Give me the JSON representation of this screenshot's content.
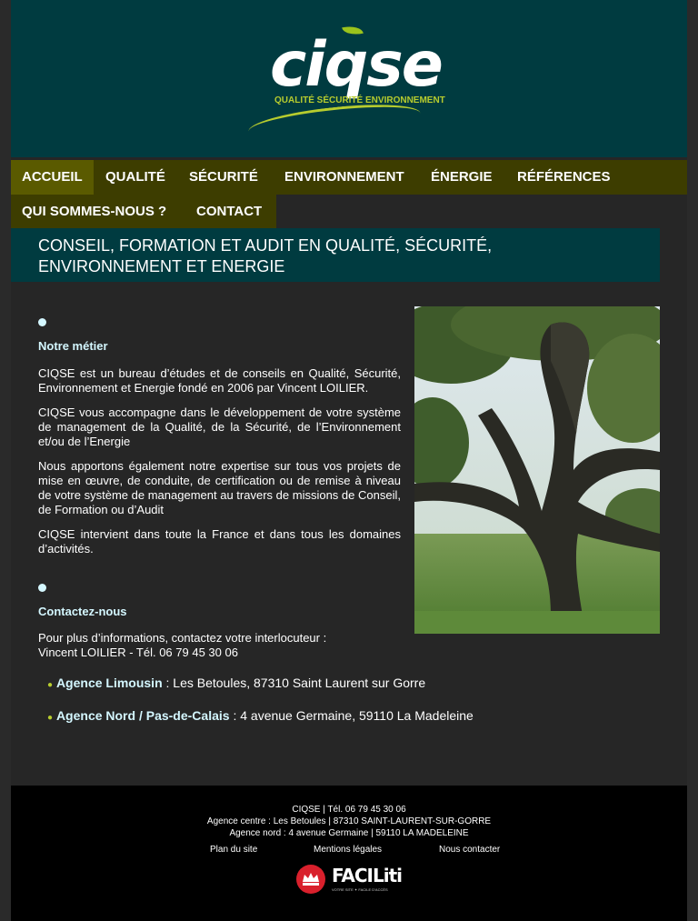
{
  "logo": {
    "name": "ciqse",
    "tagline": "QUALITÉ SÉCURITÉ ENVIRONNEMENT"
  },
  "nav": {
    "items": [
      "ACCUEIL",
      "QUALITÉ",
      "SÉCURITÉ",
      "ENVIRONNEMENT",
      "ÉNERGIE",
      "RÉFÉRENCES",
      "QUI SOMMES-NOUS ?",
      "CONTACT"
    ],
    "active": "ACCUEIL"
  },
  "banner": {
    "title": "CONSEIL, FORMATION ET AUDIT EN QUALITÉ, SÉCURITÉ, ENVIRONNEMENT ET ENERGIE"
  },
  "metier": {
    "title": "Notre métier",
    "paragraphs": [
      "CIQSE est un bureau d’études et de conseils en Qualité, Sécurité, Environnement et Energie fondé en 2006 par Vincent LOILIER.",
      "CIQSE vous accompagne dans le développement de votre système de management de la Qualité, de la Sécurité, de l’Environnement et/ou de l’Energie",
      "Nous apportons également notre expertise sur tous vos projets de mise en œuvre, de conduite, de certification ou de remise à niveau de votre système de management au travers de missions de Conseil, de Formation ou d’Audit",
      "CIQSE intervient dans toute la France et dans tous les domaines d’activités."
    ]
  },
  "contact": {
    "title": "Contactez-nous",
    "intro_line1": "Pour plus d’informations, contactez votre interlocuteur :",
    "intro_line2": "Vincent LOILIER - Tél. 06 79 45 30 06",
    "agencies": [
      {
        "name": "Agence Limousin",
        "address": " : Les Betoules, 87310 Saint Laurent sur Gorre"
      },
      {
        "name": "Agence Nord / Pas-de-Calais",
        "address": " : 4 avenue Germaine, 59110 La Madeleine"
      }
    ]
  },
  "footer": {
    "line1": "CIQSE | Tél. 06 79 45 30 06",
    "line2": "Agence centre : Les Betoules | 87310 SAINT-LAURENT-SUR-GORRE",
    "line3": "Agence nord : 4 avenue Germaine | 59110 LA MADELEINE",
    "links": [
      "Plan du site",
      "Mentions légales",
      "Nous contacter"
    ],
    "badge_text": "FACILiti",
    "badge_sub": "VOTRE SITE ✦ FACILE D'ACCÈS"
  },
  "colors": {
    "header_bg": "#003b40",
    "nav_bg": "#3d3d00",
    "nav_active": "#5a5a00",
    "accent_green": "#b7cc2e",
    "title_cyan": "#d4f7ff",
    "footer_bg": "#000000"
  }
}
